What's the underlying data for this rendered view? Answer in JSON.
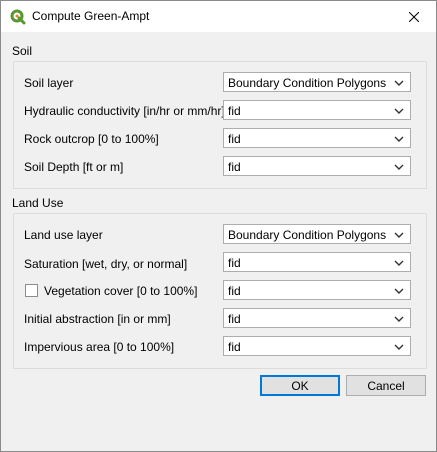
{
  "window": {
    "title": "Compute Green-Ampt"
  },
  "icons": {
    "app": "qgis-logo-icon",
    "close": "close-icon",
    "dropdown": "chevron-down-icon"
  },
  "colors": {
    "qgis_green": "#589632",
    "qgis_yellow": "#ee7913",
    "default_button_border": "#0078d7"
  },
  "soil": {
    "section_label": "Soil",
    "rows": [
      {
        "label": "Soil layer",
        "value": "Boundary Condition Polygons"
      },
      {
        "label": "Hydraulic conductivity [in/hr or mm/hr]",
        "value": "fid"
      },
      {
        "label": "Rock outcrop [0 to 100%]",
        "value": "fid"
      },
      {
        "label": "Soil Depth [ft or m]",
        "value": "fid"
      }
    ]
  },
  "landuse": {
    "section_label": "Land Use",
    "rows": [
      {
        "label": "Land use layer",
        "value": "Boundary Condition Polygons"
      },
      {
        "label": "Saturation [wet, dry, or normal]",
        "value": "fid"
      },
      {
        "label": "Vegetation cover [0 to 100%]",
        "value": "fid",
        "checked": false
      },
      {
        "label": "Initial abstraction [in or mm]",
        "value": "fid"
      },
      {
        "label": "Impervious area [0 to 100%]",
        "value": "fid"
      }
    ]
  },
  "buttons": {
    "ok": "OK",
    "cancel": "Cancel"
  }
}
